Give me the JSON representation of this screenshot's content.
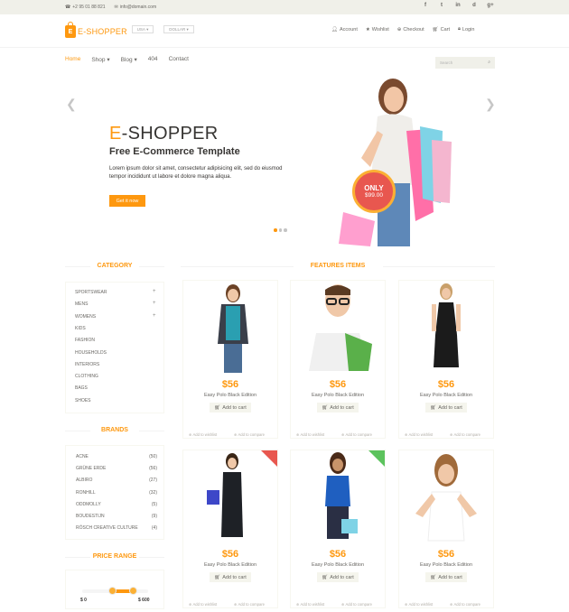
{
  "topbar": {
    "phone": "+2 95 01 88 821",
    "email": "info@domain.com",
    "social": [
      "f",
      "t",
      "in",
      "d",
      "g+"
    ]
  },
  "header": {
    "logo_text": "E-SHOPPER",
    "logo_letter": "E",
    "country": "USA",
    "currency": "DOLLAR",
    "menu": [
      {
        "label": "Account",
        "icon": "user-icon"
      },
      {
        "label": "Wishlist",
        "icon": "star-icon"
      },
      {
        "label": "Checkout",
        "icon": "crosshairs-icon"
      },
      {
        "label": "Cart",
        "icon": "shopping-cart-icon"
      },
      {
        "label": "Login",
        "icon": "lock-icon"
      }
    ]
  },
  "nav": {
    "items": [
      {
        "label": "Home",
        "active": true
      },
      {
        "label": "Shop",
        "dropdown": true
      },
      {
        "label": "Blog",
        "dropdown": true
      },
      {
        "label": "404"
      },
      {
        "label": "Contact"
      }
    ],
    "search_placeholder": "Search"
  },
  "slider": {
    "title_accent": "E",
    "title_rest": "-SHOPPER",
    "subtitle": "Free E-Commerce Template",
    "description": "Lorem ipsum dolor sit amet, consectetur adipisicing elit, sed do eiusmod tempor incididunt ut labore et dolore magna aliqua.",
    "button": "Get it now",
    "badge_only": "ONLY",
    "badge_price": "$99.00",
    "dots": 3,
    "active_dot": 0
  },
  "sidebar": {
    "category_title": "CATEGORY",
    "categories": [
      {
        "label": "SPORTSWEAR",
        "expandable": true
      },
      {
        "label": "MENS",
        "expandable": true
      },
      {
        "label": "WOMENS",
        "expandable": true
      },
      {
        "label": "KIDS"
      },
      {
        "label": "FASHION"
      },
      {
        "label": "HOUSEHOLDS"
      },
      {
        "label": "INTERIORS"
      },
      {
        "label": "CLOTHING"
      },
      {
        "label": "BAGS"
      },
      {
        "label": "SHOES"
      }
    ],
    "brands_title": "BRANDS",
    "brands": [
      {
        "name": "ACNE",
        "count": "(50)"
      },
      {
        "name": "GRÜNE ERDE",
        "count": "(56)"
      },
      {
        "name": "ALBIRO",
        "count": "(27)"
      },
      {
        "name": "RONHILL",
        "count": "(32)"
      },
      {
        "name": "ODDMOLLY",
        "count": "(5)"
      },
      {
        "name": "BOUDESTIJN",
        "count": "(9)"
      },
      {
        "name": "RÖSCH CREATIVE CULTURE",
        "count": "(4)"
      }
    ],
    "price_title": "PRICE RANGE",
    "price_min": "$ 0",
    "price_max": "$ 600"
  },
  "features": {
    "title": "FEATURES ITEMS",
    "products": [
      {
        "price": "$56",
        "name": "Easy Polo Black Edition",
        "cart": "Add to cart",
        "wishlist": "Add to wishlist",
        "compare": "Add to compare",
        "ribbon": null
      },
      {
        "price": "$56",
        "name": "Easy Polo Black Edition",
        "cart": "Add to cart",
        "wishlist": "Add to wishlist",
        "compare": "Add to compare",
        "ribbon": null
      },
      {
        "price": "$56",
        "name": "Easy Polo Black Edition",
        "cart": "Add to cart",
        "wishlist": "Add to wishlist",
        "compare": "Add to compare",
        "ribbon": null
      },
      {
        "price": "$56",
        "name": "Easy Polo Black Edition",
        "cart": "Add to cart",
        "wishlist": "Add to wishlist",
        "compare": "Add to compare",
        "ribbon": {
          "color": "#e8574f"
        }
      },
      {
        "price": "$56",
        "name": "Easy Polo Black Edition",
        "cart": "Add to cart",
        "wishlist": "Add to wishlist",
        "compare": "Add to compare",
        "ribbon": {
          "color": "#5cc35d"
        }
      },
      {
        "price": "$56",
        "name": "Easy Polo Black Edition",
        "cart": "Add to cart",
        "wishlist": "Add to wishlist",
        "compare": "Add to compare",
        "ribbon": null
      }
    ]
  },
  "colors": {
    "accent": "#fe980f",
    "topbar_bg": "#f0f0e9",
    "text": "#696763",
    "badge": "#e8574f"
  }
}
